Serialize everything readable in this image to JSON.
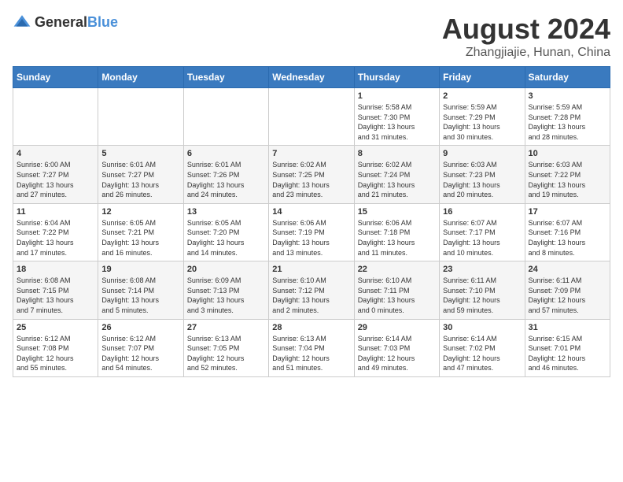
{
  "header": {
    "logo_general": "General",
    "logo_blue": "Blue",
    "month_year": "August 2024",
    "location": "Zhangjiajie, Hunan, China"
  },
  "days_of_week": [
    "Sunday",
    "Monday",
    "Tuesday",
    "Wednesday",
    "Thursday",
    "Friday",
    "Saturday"
  ],
  "weeks": [
    [
      {
        "day": "",
        "info": ""
      },
      {
        "day": "",
        "info": ""
      },
      {
        "day": "",
        "info": ""
      },
      {
        "day": "",
        "info": ""
      },
      {
        "day": "1",
        "info": "Sunrise: 5:58 AM\nSunset: 7:30 PM\nDaylight: 13 hours\nand 31 minutes."
      },
      {
        "day": "2",
        "info": "Sunrise: 5:59 AM\nSunset: 7:29 PM\nDaylight: 13 hours\nand 30 minutes."
      },
      {
        "day": "3",
        "info": "Sunrise: 5:59 AM\nSunset: 7:28 PM\nDaylight: 13 hours\nand 28 minutes."
      }
    ],
    [
      {
        "day": "4",
        "info": "Sunrise: 6:00 AM\nSunset: 7:27 PM\nDaylight: 13 hours\nand 27 minutes."
      },
      {
        "day": "5",
        "info": "Sunrise: 6:01 AM\nSunset: 7:27 PM\nDaylight: 13 hours\nand 26 minutes."
      },
      {
        "day": "6",
        "info": "Sunrise: 6:01 AM\nSunset: 7:26 PM\nDaylight: 13 hours\nand 24 minutes."
      },
      {
        "day": "7",
        "info": "Sunrise: 6:02 AM\nSunset: 7:25 PM\nDaylight: 13 hours\nand 23 minutes."
      },
      {
        "day": "8",
        "info": "Sunrise: 6:02 AM\nSunset: 7:24 PM\nDaylight: 13 hours\nand 21 minutes."
      },
      {
        "day": "9",
        "info": "Sunrise: 6:03 AM\nSunset: 7:23 PM\nDaylight: 13 hours\nand 20 minutes."
      },
      {
        "day": "10",
        "info": "Sunrise: 6:03 AM\nSunset: 7:22 PM\nDaylight: 13 hours\nand 19 minutes."
      }
    ],
    [
      {
        "day": "11",
        "info": "Sunrise: 6:04 AM\nSunset: 7:22 PM\nDaylight: 13 hours\nand 17 minutes."
      },
      {
        "day": "12",
        "info": "Sunrise: 6:05 AM\nSunset: 7:21 PM\nDaylight: 13 hours\nand 16 minutes."
      },
      {
        "day": "13",
        "info": "Sunrise: 6:05 AM\nSunset: 7:20 PM\nDaylight: 13 hours\nand 14 minutes."
      },
      {
        "day": "14",
        "info": "Sunrise: 6:06 AM\nSunset: 7:19 PM\nDaylight: 13 hours\nand 13 minutes."
      },
      {
        "day": "15",
        "info": "Sunrise: 6:06 AM\nSunset: 7:18 PM\nDaylight: 13 hours\nand 11 minutes."
      },
      {
        "day": "16",
        "info": "Sunrise: 6:07 AM\nSunset: 7:17 PM\nDaylight: 13 hours\nand 10 minutes."
      },
      {
        "day": "17",
        "info": "Sunrise: 6:07 AM\nSunset: 7:16 PM\nDaylight: 13 hours\nand 8 minutes."
      }
    ],
    [
      {
        "day": "18",
        "info": "Sunrise: 6:08 AM\nSunset: 7:15 PM\nDaylight: 13 hours\nand 7 minutes."
      },
      {
        "day": "19",
        "info": "Sunrise: 6:08 AM\nSunset: 7:14 PM\nDaylight: 13 hours\nand 5 minutes."
      },
      {
        "day": "20",
        "info": "Sunrise: 6:09 AM\nSunset: 7:13 PM\nDaylight: 13 hours\nand 3 minutes."
      },
      {
        "day": "21",
        "info": "Sunrise: 6:10 AM\nSunset: 7:12 PM\nDaylight: 13 hours\nand 2 minutes."
      },
      {
        "day": "22",
        "info": "Sunrise: 6:10 AM\nSunset: 7:11 PM\nDaylight: 13 hours\nand 0 minutes."
      },
      {
        "day": "23",
        "info": "Sunrise: 6:11 AM\nSunset: 7:10 PM\nDaylight: 12 hours\nand 59 minutes."
      },
      {
        "day": "24",
        "info": "Sunrise: 6:11 AM\nSunset: 7:09 PM\nDaylight: 12 hours\nand 57 minutes."
      }
    ],
    [
      {
        "day": "25",
        "info": "Sunrise: 6:12 AM\nSunset: 7:08 PM\nDaylight: 12 hours\nand 55 minutes."
      },
      {
        "day": "26",
        "info": "Sunrise: 6:12 AM\nSunset: 7:07 PM\nDaylight: 12 hours\nand 54 minutes."
      },
      {
        "day": "27",
        "info": "Sunrise: 6:13 AM\nSunset: 7:05 PM\nDaylight: 12 hours\nand 52 minutes."
      },
      {
        "day": "28",
        "info": "Sunrise: 6:13 AM\nSunset: 7:04 PM\nDaylight: 12 hours\nand 51 minutes."
      },
      {
        "day": "29",
        "info": "Sunrise: 6:14 AM\nSunset: 7:03 PM\nDaylight: 12 hours\nand 49 minutes."
      },
      {
        "day": "30",
        "info": "Sunrise: 6:14 AM\nSunset: 7:02 PM\nDaylight: 12 hours\nand 47 minutes."
      },
      {
        "day": "31",
        "info": "Sunrise: 6:15 AM\nSunset: 7:01 PM\nDaylight: 12 hours\nand 46 minutes."
      }
    ]
  ]
}
